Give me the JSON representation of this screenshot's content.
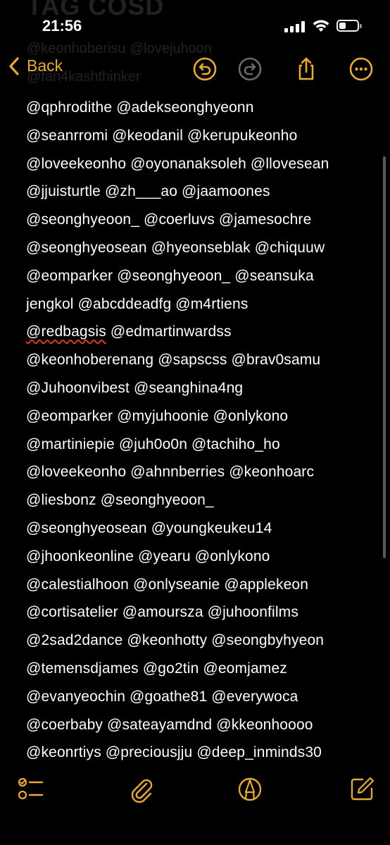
{
  "status_bar": {
    "time": "21:56"
  },
  "ghost_header": {
    "line1": "TAG COSD",
    "line2": "@keonhoberisu @lovejuhoon",
    "line3": "@fan4kashthinker"
  },
  "nav": {
    "back_label": "Back",
    "accent_color": "#e8a93a",
    "icons": [
      "chevron-left-icon",
      "undo-icon",
      "redo-icon",
      "share-icon",
      "more-icon"
    ]
  },
  "note": {
    "lines": [
      "@qphrodithe @adekseonghyeonn",
      "@seanrromi @keodanil @kerupukeonho",
      "@loveekeonho @oyonanaksoleh @llovesean",
      "@jjuisturtle @zh___ao @jaamoones",
      "@seonghyeoon_ @coerluvs  @jamesochre",
      "@seonghyeosean @hyeonseblak @chiquuw",
      "@eomparker @seonghyeoon_  @seansuka",
      "jengkol @abcddeadfg @m4rtiens",
      "@redbagsis @edmartinwardss",
      "@keonhoberenang @sapscss @brav0samu",
      "@Juhoonvibest @seanghina4ng",
      "@eomparker @myjuhoonie @onlykono",
      "@martiniepie @juh0o0n @tachiho_ho",
      "@loveekeonho @ahnnberries @keonhoarc",
      "@liesbonz @seonghyeoon_",
      "@seonghyeosean @youngkeukeu14",
      "@jhoonkeonline @yearu @onlykono",
      "@calestialhoon @onlyseanie @applekeon",
      "@cortisatelier @amoursza @juhoonfilms",
      "@2sad2dance @keonhotty @seongbyhyeon",
      "@temensdjames @go2tin @eomjamez",
      "@evanyeochin @goathe81 @everywoca",
      "@coerbaby @sateayamdnd @kkeonhoooo",
      "@keonrtiys @preciousjju @deep_inminds30"
    ],
    "line9_first": "@redbagsis",
    "line9_rest": " @edmartinwardss"
  },
  "toolbar": {
    "icons": [
      "checklist-icon",
      "paperclip-icon",
      "markup-pen-icon",
      "compose-icon"
    ]
  }
}
